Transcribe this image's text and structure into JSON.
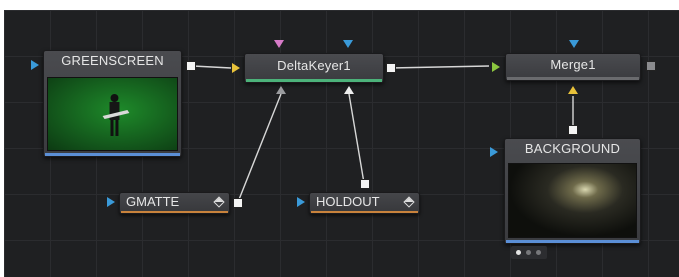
{
  "nodes": {
    "greenscreen": {
      "label": "GREENSCREEN",
      "accent": "#5b8fd6"
    },
    "deltakeyer": {
      "label": "DeltaKeyer1",
      "accent": "#4cb27a"
    },
    "merge": {
      "label": "Merge1",
      "accent": "#6a6b6e"
    },
    "background": {
      "label": "BACKGROUND",
      "accent": "#5b8fd6"
    },
    "gmatte": {
      "label": "GMATTE",
      "accent": "#c8823c"
    },
    "holdout": {
      "label": "HOLDOUT",
      "accent": "#c8823c"
    }
  },
  "colors": {
    "input_blue": "#3a9ad9",
    "input_yellow": "#e8c23a",
    "input_green": "#8cc63f",
    "input_pink": "#d77bc8",
    "input_gray": "#9a9b9e",
    "output_white": "#f4f4f4"
  },
  "icons": [
    "input-triangle-icon",
    "output-port-icon",
    "diamond-toggle-icon",
    "page-dots-icon"
  ],
  "page_indicator": {
    "pages": 3,
    "active": 1
  }
}
